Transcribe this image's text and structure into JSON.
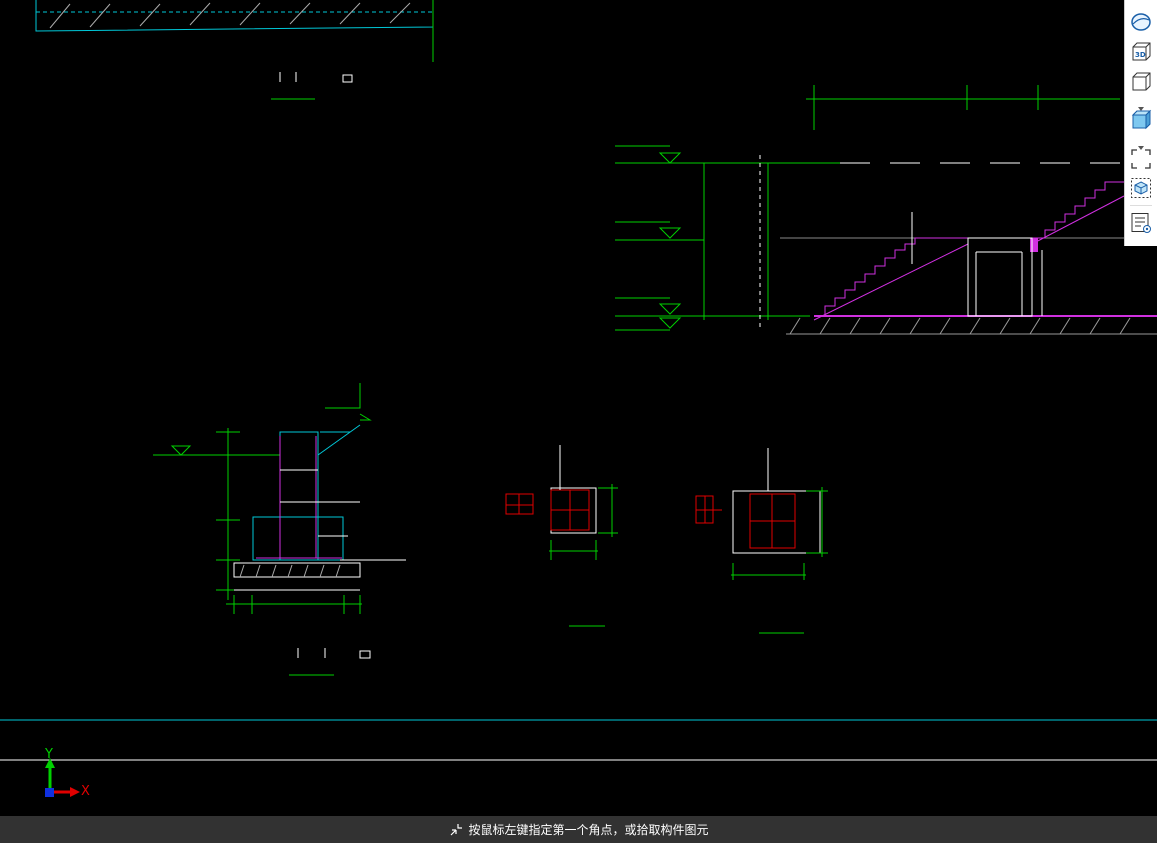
{
  "status": {
    "prompt": "按鼠标左键指定第一个角点，或拾取构件图元",
    "icon": "pick-point-icon"
  },
  "viewcube": {
    "tools": [
      "orbit-icon",
      "3d-view-icon",
      "box-view-icon",
      "shaded-box-icon",
      "fit-frame-icon",
      "component-view-icon",
      "properties-icon"
    ]
  },
  "ucs": {
    "x_label": "X",
    "y_label": "Y"
  },
  "colors": {
    "background": "#000000",
    "green": "#00d000",
    "cyan": "#00c8d8",
    "magenta": "#d030e0",
    "red": "#e00000",
    "white": "#ffffff",
    "status_bg": "#323232"
  }
}
